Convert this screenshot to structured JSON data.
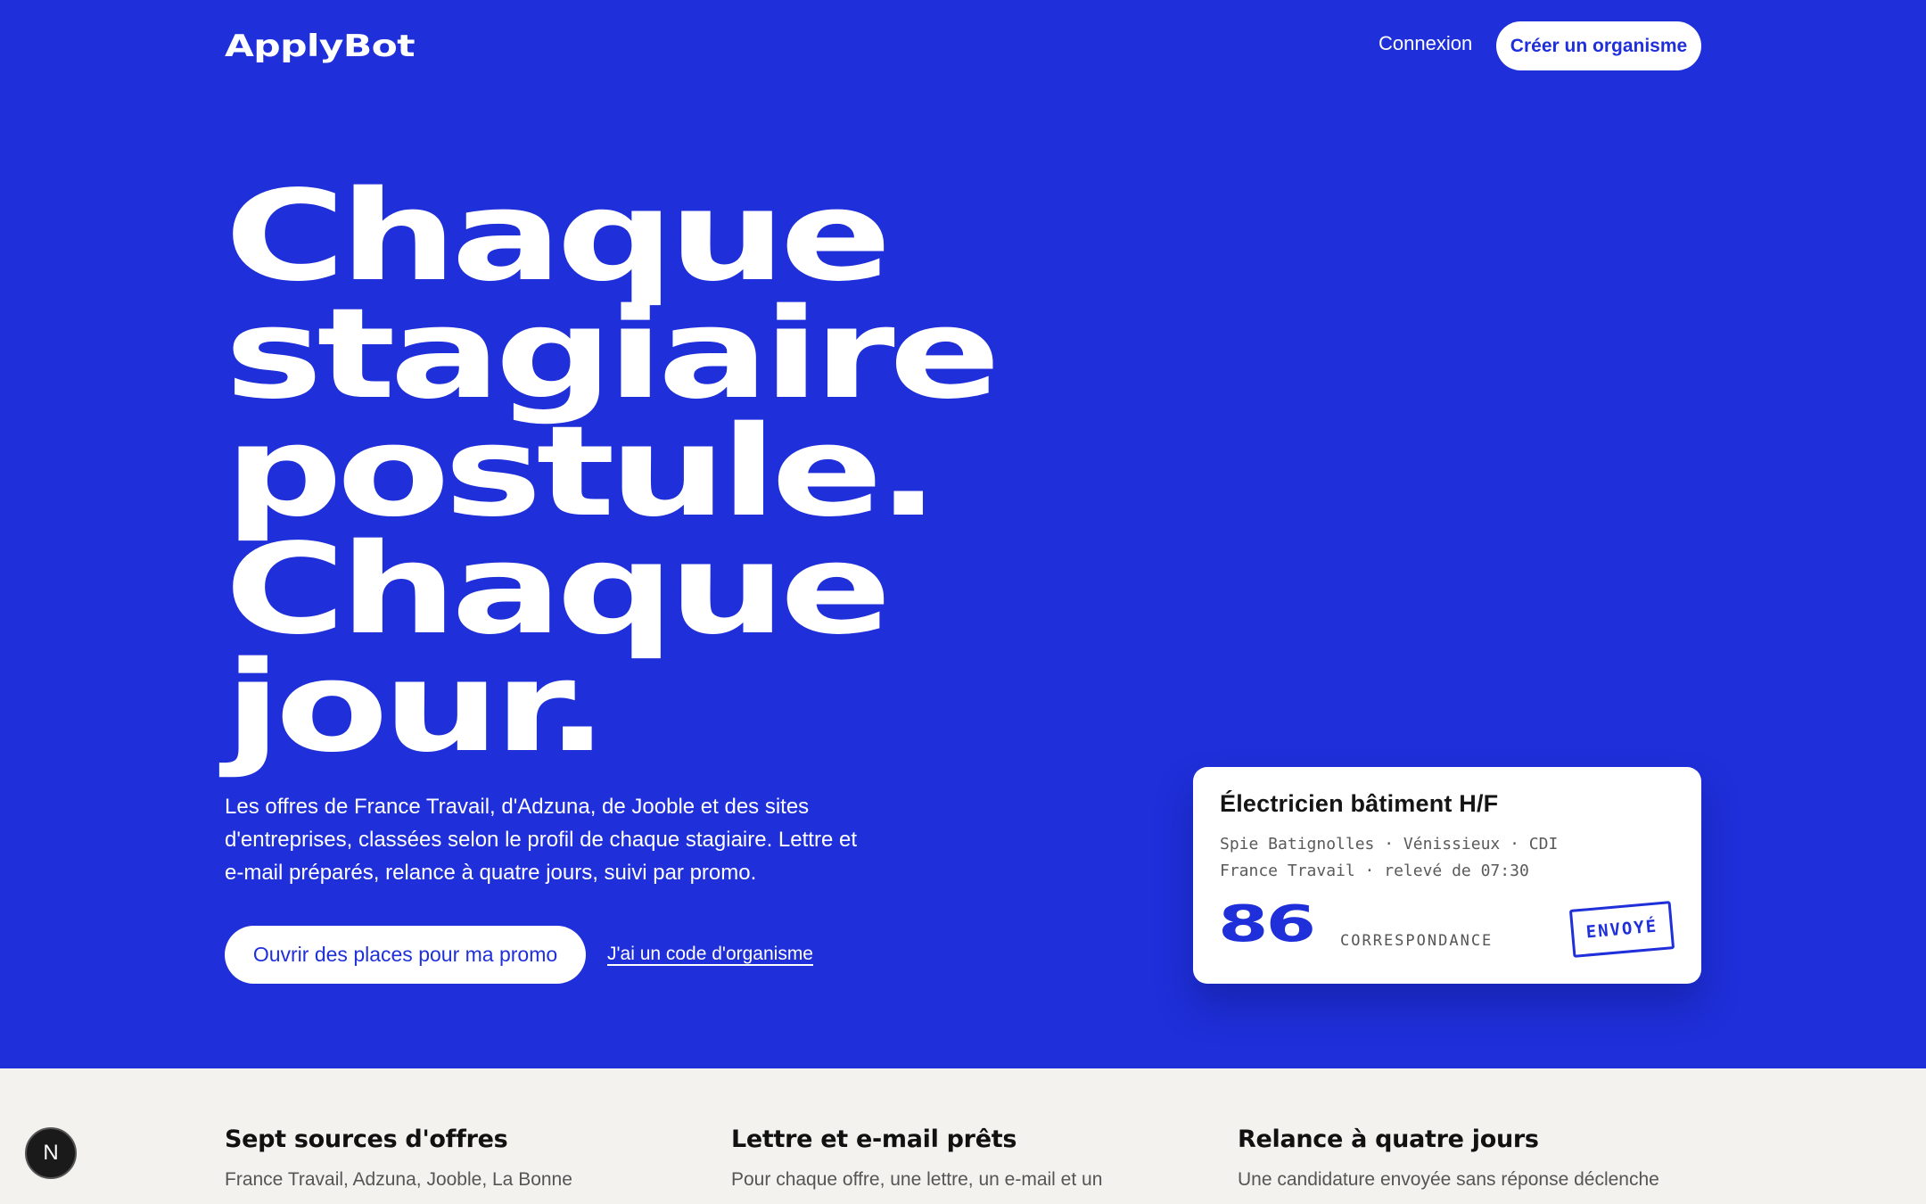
{
  "header": {
    "logo": "ApplyBot",
    "login_label": "Connexion",
    "cta_label": "Créer un organisme"
  },
  "hero": {
    "headline": [
      "Chaque",
      "stagiaire",
      "postule.",
      "Chaque",
      "jour."
    ],
    "lede": "Les offres de France Travail, d'Adzuna, de Jooble et des sites d'entreprises, classées selon le profil de chaque stagiaire. Lettre et e-mail préparés, relance à quatre jours, suivi par promo.",
    "primary_button": "Ouvrir des places pour ma promo",
    "secondary_link": "J'ai un code d'organisme"
  },
  "offer_card": {
    "title": "Électricien bâtiment H/F",
    "meta_line_1": "Spie Batignolles · Vénissieux · CDI",
    "meta_line_2": "France Travail · relevé de 07:30",
    "score": "86",
    "score_label": "CORRESPONDANCE",
    "status": "ENVOYÉ"
  },
  "features": [
    {
      "title": "Sept sources d'offres",
      "text": "France Travail, Adzuna, Jooble, La Bonne"
    },
    {
      "title": "Lettre et e-mail prêts",
      "text": "Pour chaque offre, une lettre, un e-mail et un"
    },
    {
      "title": "Relance à quatre jours",
      "text": "Une candidature envoyée sans réponse déclenche"
    }
  ],
  "dev_badge": "N",
  "colors": {
    "brand_blue": "#1f2fd9",
    "page_background": "#f4f2ee",
    "white": "#ffffff"
  }
}
